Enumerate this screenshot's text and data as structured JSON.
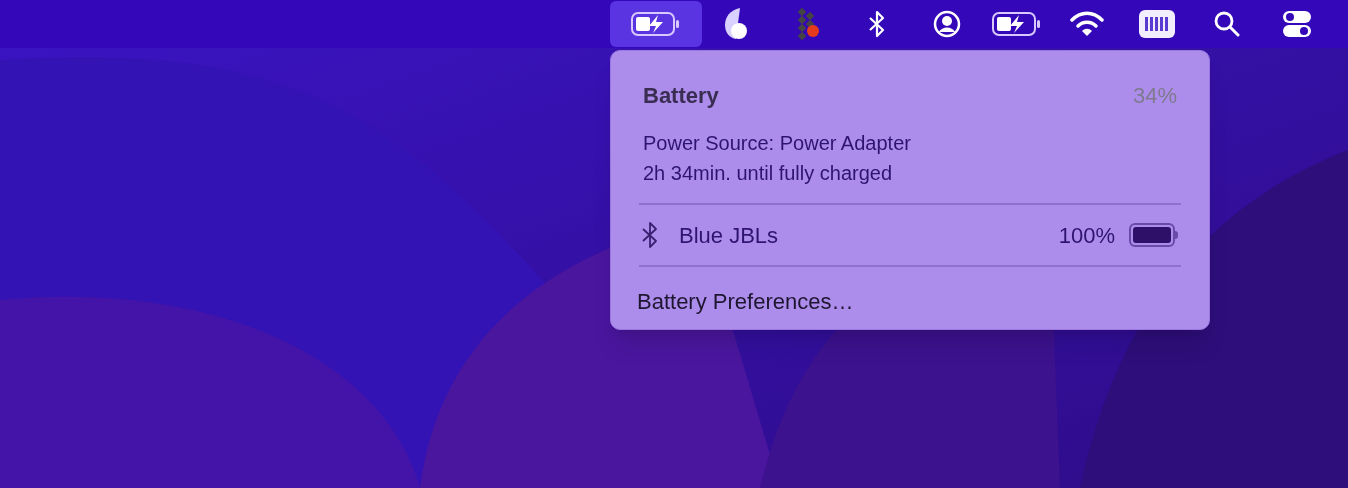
{
  "menu_bar": {
    "items": [
      {
        "kind": "battery-charging",
        "selected": true
      },
      {
        "kind": "moon",
        "selected": false
      },
      {
        "kind": "grid",
        "selected": false
      },
      {
        "kind": "bluetooth",
        "selected": false
      },
      {
        "kind": "user",
        "selected": false
      },
      {
        "kind": "battery-charging",
        "selected": false
      },
      {
        "kind": "wifi",
        "selected": false
      },
      {
        "kind": "meter",
        "selected": false
      },
      {
        "kind": "search",
        "selected": false
      },
      {
        "kind": "toggles",
        "selected": false
      }
    ]
  },
  "battery_menu": {
    "title": "Battery",
    "percent": "34%",
    "lines": [
      "Power Source: Power Adapter",
      "2h 34min. until fully charged"
    ],
    "devices": [
      {
        "name": "Blue JBLs",
        "percent": "100%",
        "level": 1
      }
    ],
    "preferences": "Battery Preferences…"
  }
}
